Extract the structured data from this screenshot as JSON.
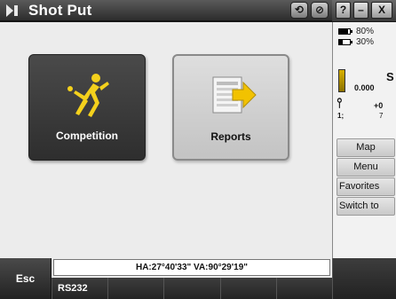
{
  "window": {
    "title": "Shot Put",
    "app_icon": "shot-put-app-icon",
    "title_buttons": [
      {
        "name": "back-icon",
        "glyph": "⟲"
      },
      {
        "name": "settings-icon",
        "glyph": "⊘"
      }
    ]
  },
  "system": {
    "help": "?",
    "minimize": "–",
    "close": "X"
  },
  "tiles": [
    {
      "label": "Competition",
      "icon": "shot-put-athlete-icon",
      "selected": false
    },
    {
      "label": "Reports",
      "icon": "report-export-icon",
      "selected": true
    }
  ],
  "status": {
    "battery1": "80%",
    "battery1_level": 0.8,
    "battery2": "30%",
    "battery2_level": 0.3,
    "instrument_label": "S",
    "instrument_value": "0.000",
    "prism_label": "1;",
    "meas_value": "+0",
    "meas_sub": "7"
  },
  "side_menu": [
    {
      "label": "Map",
      "accel": "M"
    },
    {
      "label": "Menu",
      "accel": "e"
    },
    {
      "label": "Favorites",
      "accel": "a"
    },
    {
      "label": "Switch to",
      "accel": "w"
    }
  ],
  "bottom": {
    "esc": "Esc",
    "angles": "HA:27°40'33\"   VA:90°29'19\"",
    "softkeys": [
      "RS232",
      "",
      "",
      "",
      ""
    ]
  },
  "colors": {
    "accent_yellow": "#f2c200",
    "tile_dark": "#3a3a3a",
    "tile_light": "#d0d0d0"
  }
}
